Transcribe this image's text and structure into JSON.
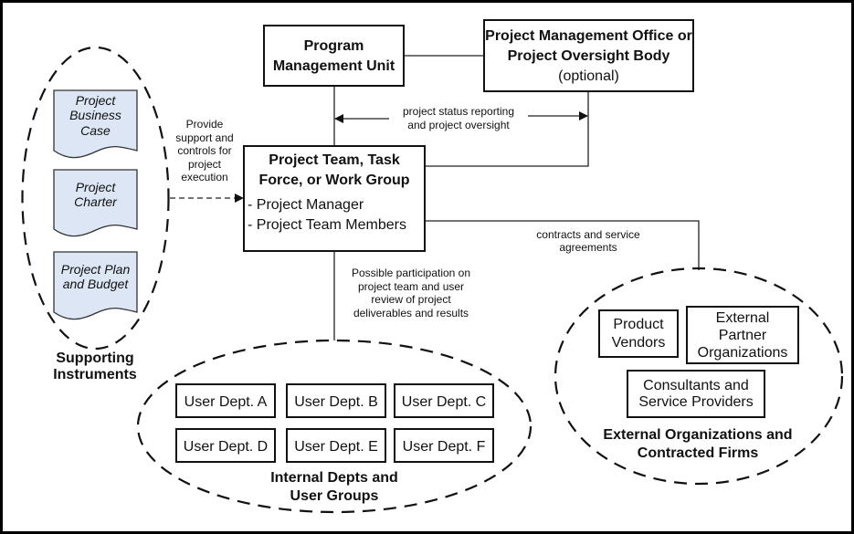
{
  "nodes": {
    "pmu": {
      "lines": [
        "Program",
        "Management Unit"
      ]
    },
    "pmo": {
      "lines": [
        "Project Management Office or",
        "Project Oversight Body",
        "(optional)"
      ]
    },
    "team": {
      "title": [
        "Project Team, Task",
        "Force, or Work Group"
      ],
      "members": [
        "- Project Manager",
        "- Project Team Members"
      ]
    }
  },
  "supporting": {
    "docs": [
      {
        "lines": [
          "Project",
          "Business",
          "Case"
        ]
      },
      {
        "lines": [
          "Project",
          "Charter"
        ]
      },
      {
        "lines": [
          "Project Plan",
          "and Budget"
        ]
      }
    ],
    "label": [
      "Supporting",
      "Instruments"
    ],
    "fill_color": "#dce6f4"
  },
  "internal": {
    "depts": [
      "User Dept. A",
      "User Dept. B",
      "User Dept. C",
      "User Dept. D",
      "User Dept. E",
      "User Dept. F"
    ],
    "label": [
      "Internal Depts and",
      "User Groups"
    ]
  },
  "external": {
    "product": [
      "Product",
      "Vendors"
    ],
    "partner": [
      "External",
      "Partner",
      "Organizations"
    ],
    "consultants": [
      "Consultants and",
      "Service Providers"
    ],
    "label": [
      "External Organizations and",
      "Contracted Firms"
    ]
  },
  "edges": {
    "support": [
      "Provide",
      "support and",
      "controls for",
      "project",
      "execution"
    ],
    "oversight": [
      "project status reporting",
      "and project oversight"
    ],
    "contracts": [
      "contracts and service",
      "agreements"
    ],
    "participation": [
      "Possible participation on",
      "project team and user",
      "review of project",
      "deliverables and results"
    ]
  }
}
